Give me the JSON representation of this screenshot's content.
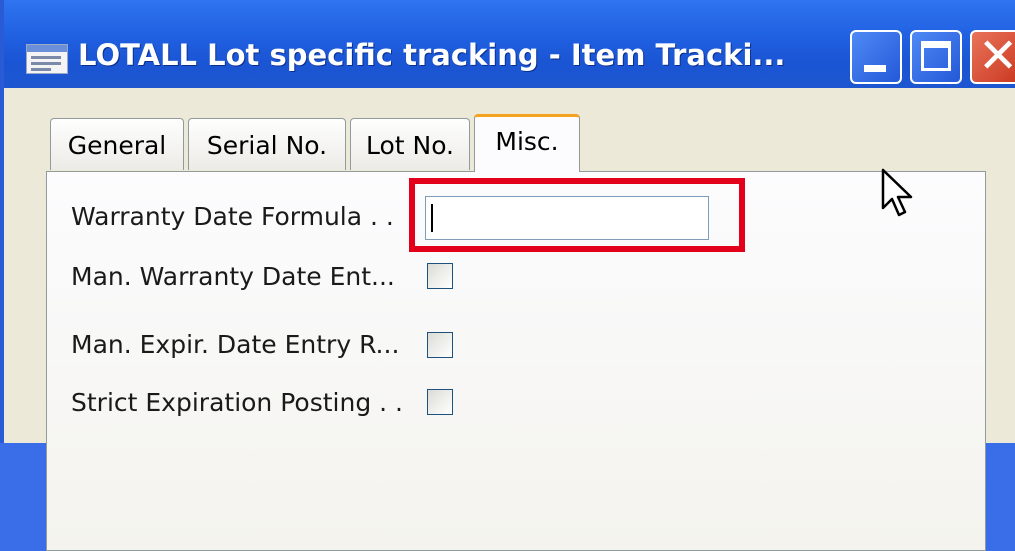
{
  "window": {
    "title": "LOTALL Lot specific tracking - Item Tracki..."
  },
  "titlebar_buttons": [
    {
      "name": "minimize",
      "icon": "minimize-icon"
    },
    {
      "name": "maximize",
      "icon": "maximize-icon"
    },
    {
      "name": "close",
      "icon": "close-icon",
      "glyph": "✕"
    }
  ],
  "tabs": [
    {
      "label": "General",
      "active": false
    },
    {
      "label": "Serial No.",
      "active": false
    },
    {
      "label": "Lot No.",
      "active": false
    },
    {
      "label": "Misc.",
      "active": true
    }
  ],
  "fields": {
    "warranty_date_formula": {
      "label": "Warranty Date Formula . .",
      "value": ""
    },
    "man_warranty_date_entry": {
      "label": "Man. Warranty Date Ent...",
      "checked": false
    },
    "man_expir_date_entry": {
      "label": "Man. Expir. Date Entry R...",
      "checked": false
    },
    "strict_expiration_posting": {
      "label": "Strict Expiration Posting . .",
      "checked": false
    }
  },
  "colors": {
    "titlebar": "#1f5fe0",
    "active_tab_accent": "#f3a321",
    "highlight": "#e3001b"
  }
}
